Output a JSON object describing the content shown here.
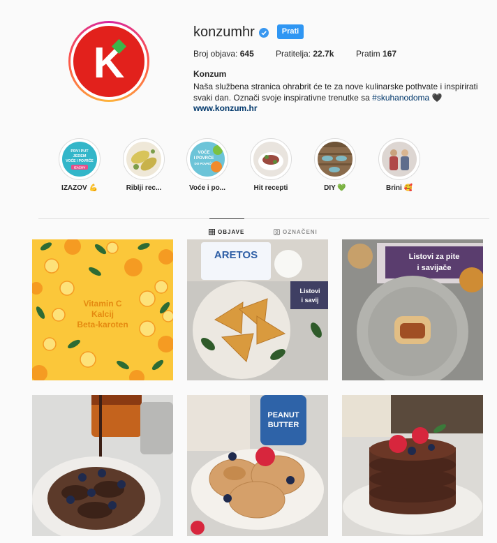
{
  "profile": {
    "username": "konzumhr",
    "follow_label": "Prati",
    "stats": {
      "posts_label": "Broj objava:",
      "posts_value": "645",
      "followers_label": "Pratitelja:",
      "followers_value": "22.7k",
      "following_label": "Pratim",
      "following_value": "167"
    },
    "bio_name": "Konzum",
    "bio_text": "Naša službena stranica ohrabrit će te za nove kulinarske pothvate i inspirirati svaki dan. Označi svoje inspirativne trenutke sa",
    "bio_hashtag": "#skuhanodoma",
    "bio_heart": "🖤",
    "bio_link": "www.konzum.hr",
    "avatar_letter": "K",
    "brand_colors": {
      "red": "#e2211c",
      "green": "#3ab54a",
      "follow_blue": "#2f96f3"
    }
  },
  "highlights": [
    {
      "label": "IZAZOV 💪",
      "cover_text": [
        "PRVI PUT",
        "JEDEM",
        "VOĆE I POVRĆE",
        "IZAZOV"
      ]
    },
    {
      "label": "Riblji rec..."
    },
    {
      "label": "Voće i po...",
      "cover_text": [
        "VOĆE",
        "I POVRĆE",
        "DO POVRĆE"
      ]
    },
    {
      "label": "Hit recepti"
    },
    {
      "label": "DIY 💚"
    },
    {
      "label": "Brini 🥰"
    }
  ],
  "tabs": [
    {
      "label": "OBJAVE",
      "icon": "grid-icon",
      "active": true
    },
    {
      "label": "OZNAČENI",
      "icon": "tagged-icon",
      "active": false
    }
  ],
  "posts": [
    {
      "id": 1,
      "text_lines": [
        "Vitamin C",
        "Kalcij",
        "Beta-karoten"
      ]
    },
    {
      "id": 2,
      "package_text": [
        "ARETOS"
      ],
      "box_text": [
        "Listovi",
        "i savij"
      ]
    },
    {
      "id": 3,
      "box_text": [
        "Listovi za pite",
        "i savijače"
      ]
    },
    {
      "id": 4
    },
    {
      "id": 5,
      "jar_text": [
        "PEANUT",
        "BUTTER"
      ]
    },
    {
      "id": 6
    }
  ]
}
